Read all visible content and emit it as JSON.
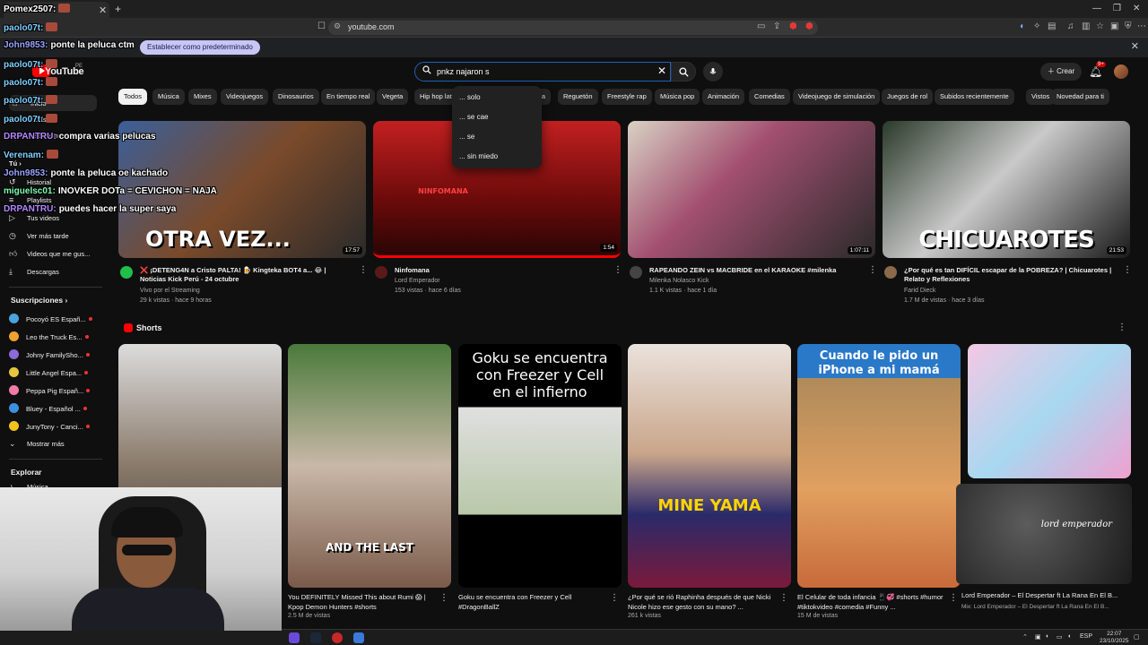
{
  "browser": {
    "url": "youtube.com",
    "default_button": "Establecer como predeterminado"
  },
  "youtube": {
    "wordmark": "YouTube",
    "country": "PE",
    "search_value": "pnkz najaron s",
    "create_label": "Crear",
    "notif_count": "9+"
  },
  "suggestions": [
    "... solo",
    "... se cae",
    "... se",
    "... sin miedo"
  ],
  "chips": [
    "Todos",
    "Música",
    "Mixes",
    "Videojuegos",
    "Dinosaurios",
    "En tiempo real",
    "Vegeta",
    "Hip hop latino",
    "mexicana",
    "Reguetón",
    "Freestyle rap",
    "Música pop",
    "Animación",
    "Comedias",
    "Videojuego de simulación",
    "Juegos de rol",
    "Subidos recientemente",
    "Vistos",
    "Novedad para ti"
  ],
  "sidebar": {
    "top": [
      "Inicio",
      "Shorts",
      "Suscripciones"
    ],
    "you_label": "Tú",
    "you_items": [
      "Historial",
      "Playlists",
      "Tus videos",
      "Ver más tarde",
      "Videos que me gus...",
      "Descargas"
    ],
    "subs_head": "Suscripciones",
    "channels": [
      "Pocoyó ES Españ...",
      "Leo the Truck Es...",
      "Johny FamilySho...",
      "Little Angel Espa...",
      "Peppa Pig Españ...",
      "Bluey - Español ...",
      "JunyTony - Canci..."
    ],
    "show_more": "Mostrar más",
    "explore_head": "Explorar",
    "explore_first": "Música"
  },
  "videos": [
    {
      "title": "❌ ¡DETENG4N a Cristo PALTA! 🍺 Kingteka BOT4 a... 😂 | Noticias Kick Perú - 24 octubre",
      "channel": "Vivo por el Streaming",
      "meta": "29 k vistas · hace 9 horas",
      "duration": "17:57",
      "overlay": "OTRA VEZ...",
      "color": "#2e7d32"
    },
    {
      "title": "Ninfomana",
      "channel": "Lord Emperador",
      "meta": "153 vistas · hace 6 días",
      "duration": "1:54",
      "overlay": "NINFOMANA",
      "color": "#8a1a1a"
    },
    {
      "title": "RAPEANDO ZEIN vs MACBRIDE en el KARAOKE #milenka",
      "channel": "Milenka Nolasco Kick",
      "meta": "1.1 K vistas · hace 1 día",
      "duration": "1:07:11",
      "overlay": "",
      "color": "#5a2a4a"
    },
    {
      "title": "¿Por qué es tan DIFÍCIL escapar de la POBREZA? | Chicuarotes | Relato y Reflexiones",
      "channel": "Farid Dieck",
      "meta": "1.7 M de vistas · hace 3 días",
      "duration": "21:53",
      "overlay": "CHICUAROTES",
      "color": "#3a3a3a"
    }
  ],
  "shorts_head": "Shorts",
  "shorts": [
    {
      "title": "",
      "views": ""
    },
    {
      "title": "You DEFINITELY Missed This about Rumi 😱 | Kpop Demon Hunters #shorts",
      "views": "2.5 M de vistas",
      "overlay": "AND THE LAST"
    },
    {
      "title": "Goku se encuentra con Freezer y Cell #DragonBallZ",
      "views": "",
      "overlay": "Goku se encuentra con Freezer y Cell en el infierno"
    },
    {
      "title": "¿Por qué se rió Raphinha después de que Nicki Nicole hizo ese gesto con su mano? ...",
      "views": "261 k vistas",
      "overlay": "MINE YAMA"
    },
    {
      "title": "El Celular de toda infancia 📱💞 #shorts #humor #tiktokvideo #comedia #Funny ...",
      "views": "15 M de vistas",
      "overlay": "Cuando le pido un iPhone a mi mamá"
    },
    {
      "title": "",
      "views": ""
    }
  ],
  "pip": {
    "title": "Lord Emperador – El Despertar ft La Rana En El B...",
    "sub": "Mix: Lord Emperador – El Despertar ft La Rana En El B...",
    "art": "lord emperador"
  },
  "chat": [
    {
      "user": "Pomex2507:",
      "msg": "",
      "color": "#ffffff"
    },
    {
      "user": "paolo07t:",
      "msg": "",
      "color": "#7fd0ff"
    },
    {
      "user": "John9853:",
      "msg": "ponte la peluca ctm",
      "color": "#9aa4ff"
    },
    {
      "user": "paolo07t:",
      "msg": "",
      "color": "#7fd0ff"
    },
    {
      "user": "paolo07t:",
      "msg": "",
      "color": "#7fd0ff"
    },
    {
      "user": "paolo07t:",
      "msg": "",
      "color": "#7fd0ff"
    },
    {
      "user": "paolo07t:",
      "msg": "",
      "color": "#7fd0ff"
    },
    {
      "user": "DRPANTRU:",
      "msg": "compra varias pelucas",
      "color": "#b388ff"
    },
    {
      "user": "Verenam:",
      "msg": "",
      "color": "#7fd0ff"
    },
    {
      "user": "John9853:",
      "msg": "ponte la peluca oe kachado",
      "color": "#9aa4ff"
    },
    {
      "user": "miguelsc01:",
      "msg": "INOVKER DOTa = CEVICHON = NAJA",
      "color": "#7fffb0"
    },
    {
      "user": "DRPANTRU:",
      "msg": "puedes hacer la super saya",
      "color": "#b388ff"
    }
  ],
  "taskbar": {
    "lang": "ESP",
    "time": "22:07",
    "date": "23/10/2025"
  }
}
